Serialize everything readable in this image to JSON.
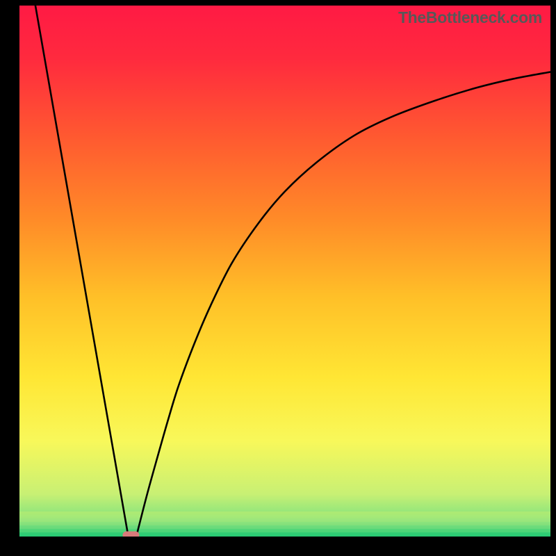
{
  "watermark": "TheBottleneck.com",
  "chart_data": {
    "type": "line",
    "xlim": [
      0,
      100
    ],
    "ylim": [
      0,
      100
    ],
    "title": "",
    "xlabel": "",
    "ylabel": "",
    "grid": false,
    "legend": false,
    "gradient_stops": [
      {
        "offset": 0.0,
        "color": "#ff1a44"
      },
      {
        "offset": 0.1,
        "color": "#ff2a3e"
      },
      {
        "offset": 0.25,
        "color": "#ff5a30"
      },
      {
        "offset": 0.4,
        "color": "#ff8a28"
      },
      {
        "offset": 0.55,
        "color": "#ffc028"
      },
      {
        "offset": 0.7,
        "color": "#ffe634"
      },
      {
        "offset": 0.82,
        "color": "#f8f85a"
      },
      {
        "offset": 0.92,
        "color": "#c8f074"
      },
      {
        "offset": 0.97,
        "color": "#7de27e"
      },
      {
        "offset": 1.0,
        "color": "#21c772"
      }
    ],
    "series": [
      {
        "name": "left-line",
        "kind": "straight",
        "x": [
          3.0,
          20.5
        ],
        "y": [
          100.0,
          0.0
        ]
      },
      {
        "name": "right-curve",
        "kind": "curve",
        "x": [
          22.0,
          24.0,
          26.0,
          28.0,
          30.0,
          33.0,
          36.0,
          40.0,
          45.0,
          50.0,
          56.0,
          63.0,
          70.0,
          78.0,
          86.0,
          93.0,
          100.0
        ],
        "y": [
          0.0,
          7.8,
          15.0,
          22.0,
          28.5,
          36.5,
          43.5,
          51.5,
          59.0,
          65.0,
          70.5,
          75.5,
          79.0,
          82.0,
          84.5,
          86.2,
          87.5
        ]
      }
    ],
    "marker": {
      "name": "optimum-marker",
      "x": 21.0,
      "y": 0.0,
      "color": "#d87a7a"
    }
  }
}
